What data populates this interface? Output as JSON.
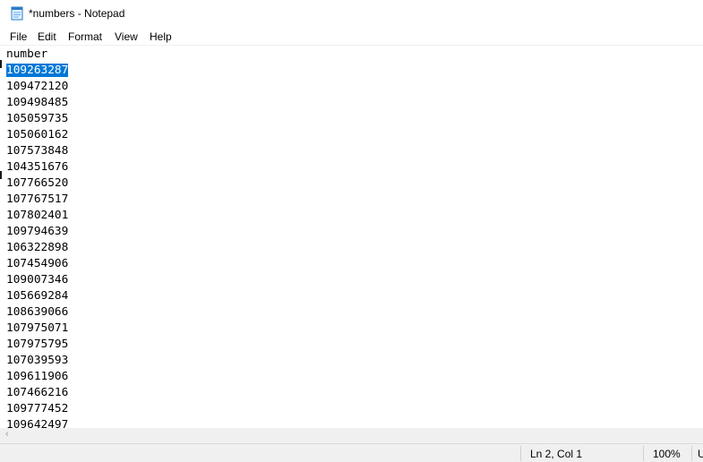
{
  "window": {
    "title": "*numbers - Notepad"
  },
  "menu": [
    "File",
    "Edit",
    "Format",
    "View",
    "Help"
  ],
  "editor": {
    "header_line": "number",
    "selected_line_index": 1,
    "lines": [
      "number",
      "109263287",
      "109472120",
      "109498485",
      "105059735",
      "105060162",
      "107573848",
      "104351676",
      "107766520",
      "107767517",
      "107802401",
      "109794639",
      "106322898",
      "107454906",
      "109007346",
      "105669284",
      "108639066",
      "107975071",
      "107975795",
      "107039593",
      "109611906",
      "107466216",
      "109777452",
      "109642497"
    ]
  },
  "status": {
    "position": "Ln 2, Col 1",
    "zoom": "100%",
    "encoding_fragment": "U"
  },
  "colors": {
    "selection": "#0078d7",
    "chrome": "#f0f0f0"
  },
  "icons": {
    "app": "notepad-icon",
    "scroll_left": "chevron-left-icon"
  }
}
